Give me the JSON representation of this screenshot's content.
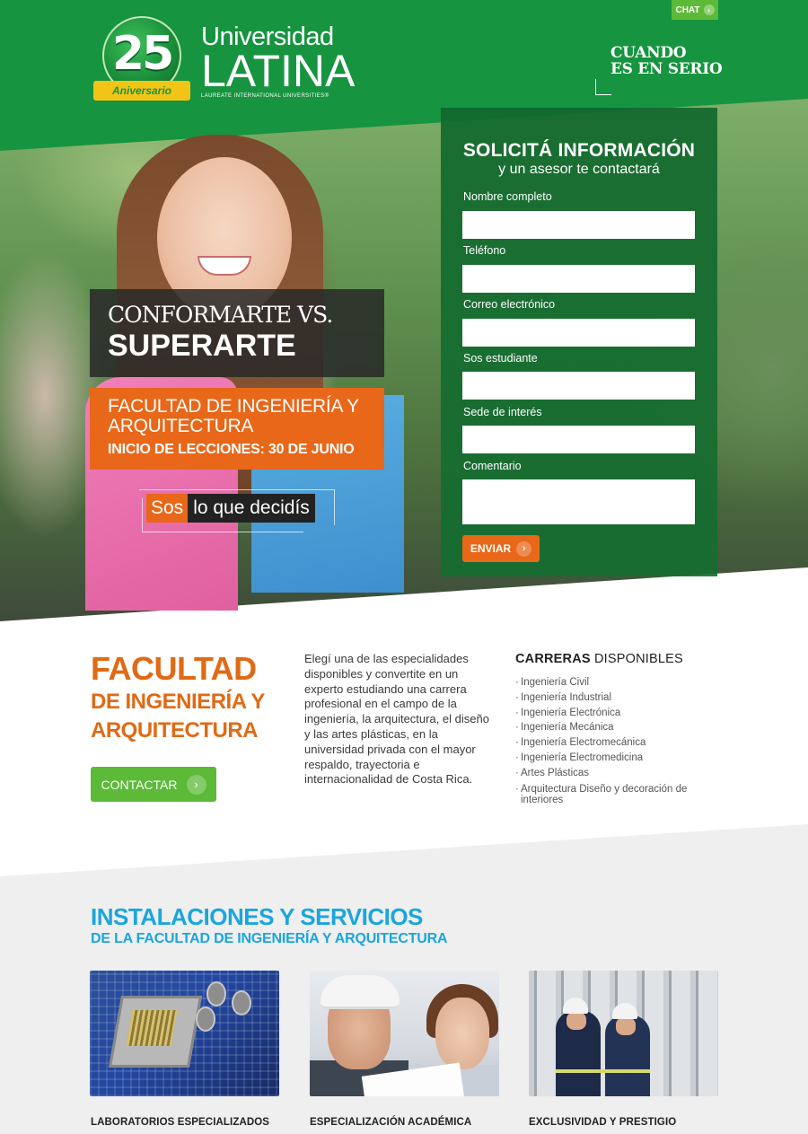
{
  "header": {
    "chat_label": "CHAT",
    "logo": {
      "number": "25",
      "ribbon": "Aniversario",
      "line1": "Universidad",
      "line2": "LATINA",
      "line3": "LAUREATE INTERNATIONAL UNIVERSITIES®"
    },
    "slogan_line1": "CUANDO",
    "slogan_line2": "ES EN SERIO"
  },
  "hero": {
    "tagline_light": "CONFORMARTE VS.",
    "tagline_bold": "SUPERARTE",
    "faculty": "FACULTAD DE INGENIERÍA Y ARQUITECTURA",
    "start_date": "INICIO DE LECCIONES: 30 DE JUNIO",
    "sos_word": "Sos",
    "sos_rest": "lo que decidís"
  },
  "form": {
    "title": "SOLICITÁ INFORMACIÓN",
    "subtitle": "y un asesor te contactará",
    "fields": [
      {
        "label": "Nombre completo",
        "value": ""
      },
      {
        "label": "Teléfono",
        "value": ""
      },
      {
        "label": "Correo electrónico",
        "value": ""
      },
      {
        "label": "Sos estudiante",
        "value": ""
      },
      {
        "label": "Sede de interés",
        "value": ""
      },
      {
        "label": "Comentario",
        "value": ""
      }
    ],
    "submit_label": "ENVIAR"
  },
  "faculty_section": {
    "title1": "FACULTAD",
    "title2": "DE INGENIERÍA Y",
    "title3": "ARQUITECTURA",
    "contact_label": "CONTACTAR",
    "description": "Elegí una de las especialidades disponibles y convertite en un experto estudiando una carrera profesional en el campo de la ingeniería, la arquitectura, el diseño y las artes plásticas, en la universidad privada con el mayor respaldo, trayectoria e internacionalidad de Costa Rica.",
    "careers_title_bold": "CARRERAS",
    "careers_title_rest": "DISPONIBLES",
    "careers": [
      "Ingeniería Civil",
      "Ingeniería Industrial",
      "Ingeniería Electrónica",
      "Ingeniería Mecánica",
      "Ingeniería Electromecánica",
      "Ingeniería Electromedicina",
      "Artes Plásticas",
      "Arquitectura Diseño y decoración de interiores"
    ]
  },
  "facilities": {
    "title": "INSTALACIONES Y SERVICIOS",
    "subtitle": "DE LA FACULTAD DE INGENIERÍA Y ARQUITECTURA",
    "cards": [
      {
        "label": "LABORATORIOS ESPECIALIZADOS"
      },
      {
        "label": "ESPECIALIZACIÓN ACADÉMICA"
      },
      {
        "label": "EXCLUSIVIDAD Y PRESTIGIO"
      }
    ]
  },
  "colors": {
    "brand_green": "#16943f",
    "accent_orange": "#e86719",
    "accent_blue": "#1aa6dc",
    "button_green": "#5cba38"
  }
}
